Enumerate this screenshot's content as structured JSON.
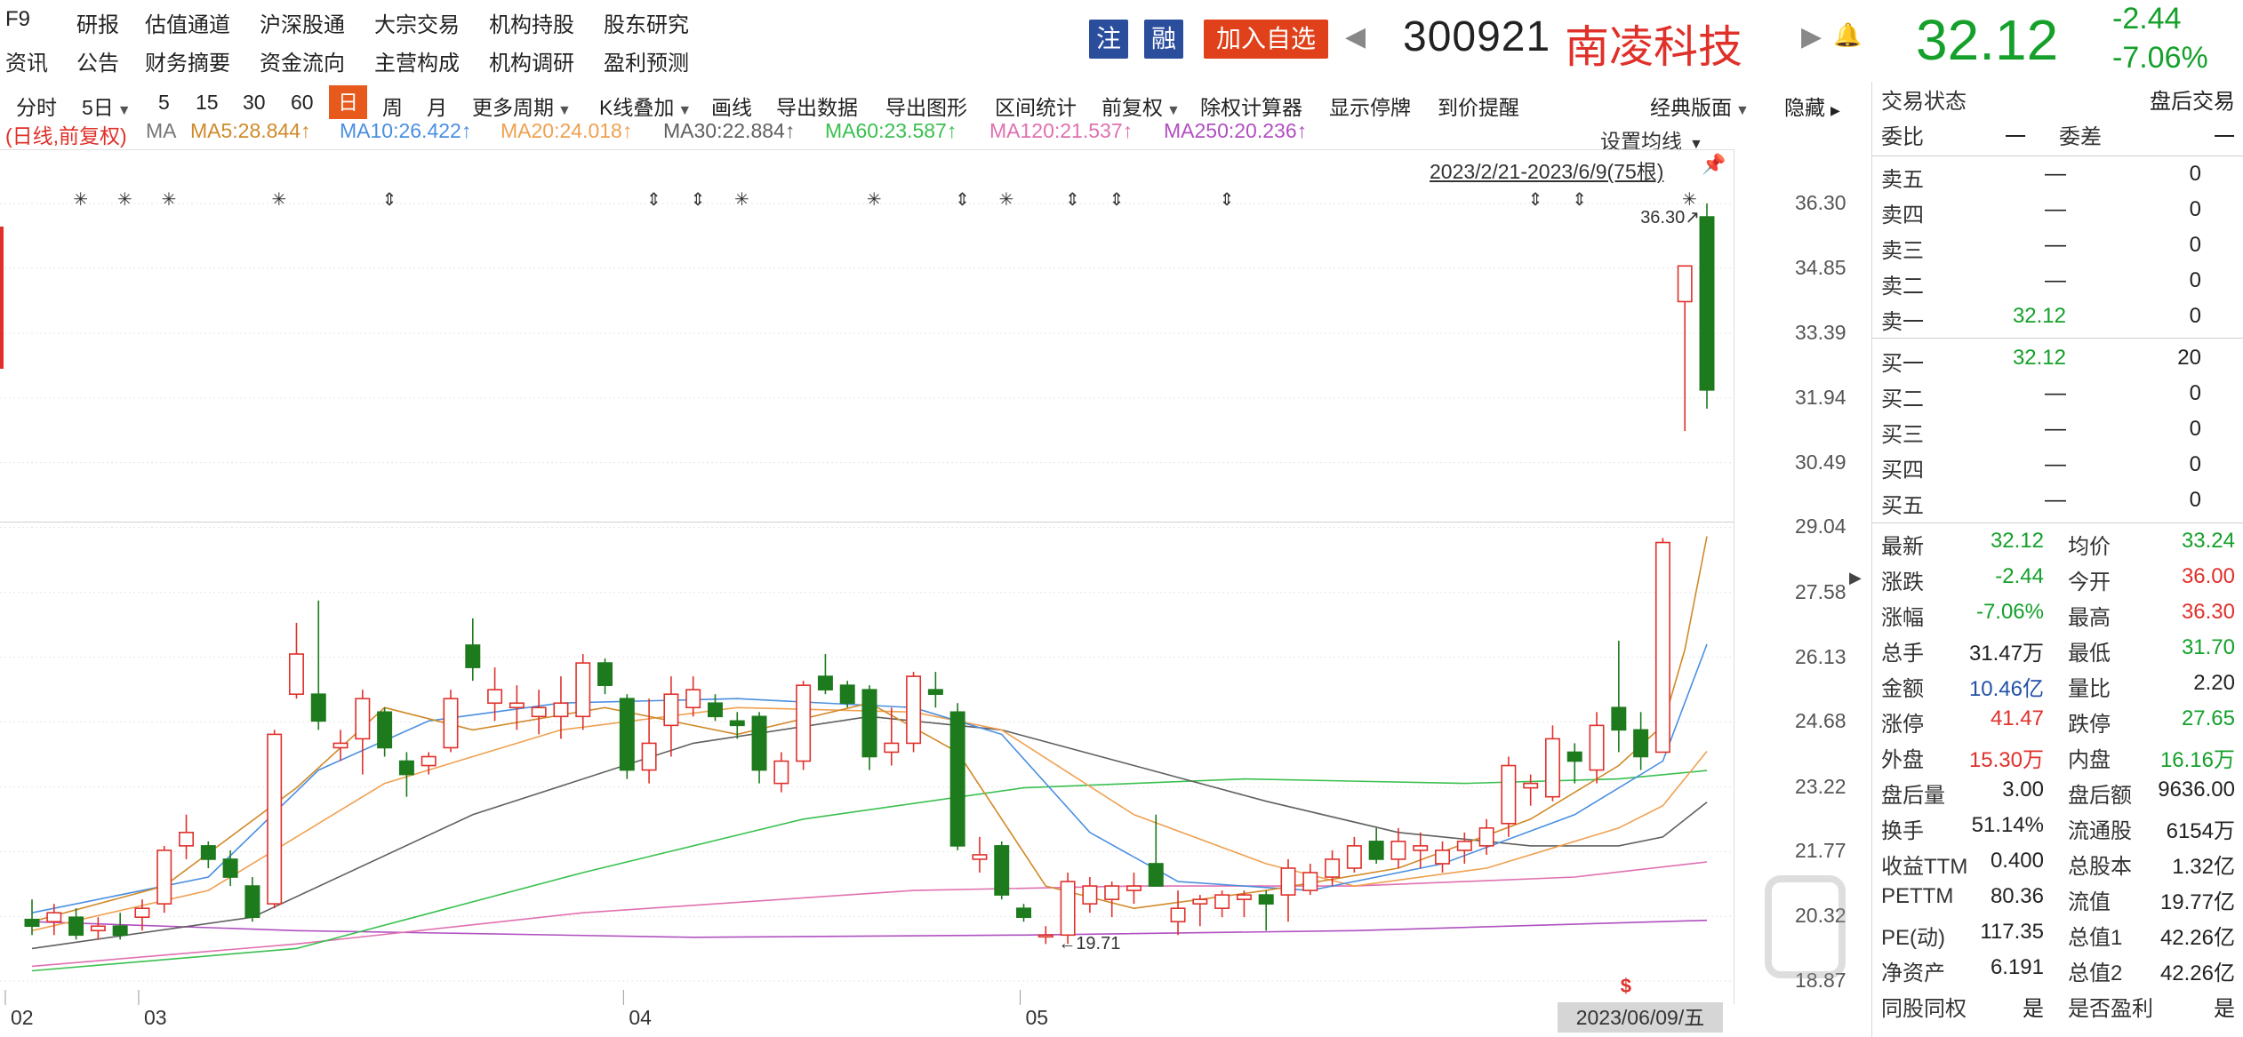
{
  "nav": {
    "row1": [
      "F9",
      "研报",
      "估值通道",
      "沪深股通",
      "大宗交易",
      "机构持股",
      "股东研究"
    ],
    "row2": [
      "资讯",
      "公告",
      "财务摘要",
      "资金流向",
      "主营构成",
      "机构调研",
      "盈利预测"
    ]
  },
  "header": {
    "tag_zhu": "注",
    "tag_rong": "融",
    "add_watch": "加入自选",
    "code": "300921",
    "name": "南凌科技",
    "price": "32.12",
    "change": "-2.44",
    "change_pct": "-7.06%"
  },
  "toolbar": {
    "items": [
      "分时",
      "5日",
      "5",
      "15",
      "30",
      "60",
      "日",
      "周",
      "月",
      "更多周期",
      "K线叠加",
      "画线",
      "导出数据",
      "导出图形",
      "区间统计",
      "前复权",
      "除权计算器",
      "显示停牌",
      "到价提醒",
      "经典版面",
      "隐藏"
    ],
    "active": "日"
  },
  "ma_legend": {
    "mode": "(日线,前复权)",
    "ma": "MA",
    "ma5": "MA5:28.844↑",
    "ma10": "MA10:26.422↑",
    "ma20": "MA20:24.018↑",
    "ma30": "MA30:22.884↑",
    "ma60": "MA60:23.587↑",
    "ma120": "MA120:21.537↑",
    "ma250": "MA250:20.236↑",
    "colors": {
      "ma5": "#d08a2a",
      "ma10": "#4a8fe0",
      "ma20": "#f0a050",
      "ma30": "#606060",
      "ma60": "#3ac050",
      "ma120": "#e070b0",
      "ma250": "#b050c0"
    }
  },
  "chart_controls": {
    "set_ma": "设置均线",
    "range": "2023/2/21-2023/6/9(75根)"
  },
  "chart_data": {
    "type": "candlestick",
    "ylim": [
      18.87,
      36.3
    ],
    "y_ticks": [
      "36.30",
      "34.85",
      "33.39",
      "31.94",
      "30.49",
      "29.04",
      "27.58",
      "26.13",
      "24.68",
      "23.22",
      "21.77",
      "20.32",
      "18.87"
    ],
    "x_ticks": [
      "02",
      "03",
      "04",
      "05"
    ],
    "annotations": {
      "high_label": "36.30",
      "low_label": "19.71"
    },
    "current_date": "2023/06/09/五",
    "up_color": "#e0302a",
    "down_color": "#1d7a1d",
    "candles": [
      {
        "o": 20.25,
        "h": 20.7,
        "l": 19.9,
        "c": 20.1
      },
      {
        "o": 20.2,
        "h": 20.6,
        "l": 19.9,
        "c": 20.4
      },
      {
        "o": 20.3,
        "h": 20.5,
        "l": 19.8,
        "c": 19.9
      },
      {
        "o": 20.0,
        "h": 20.3,
        "l": 19.8,
        "c": 20.1
      },
      {
        "o": 20.1,
        "h": 20.4,
        "l": 19.8,
        "c": 19.9
      },
      {
        "o": 20.3,
        "h": 20.7,
        "l": 20.0,
        "c": 20.5
      },
      {
        "o": 20.6,
        "h": 21.9,
        "l": 20.4,
        "c": 21.8
      },
      {
        "o": 21.9,
        "h": 22.6,
        "l": 21.6,
        "c": 22.2
      },
      {
        "o": 21.9,
        "h": 22.0,
        "l": 21.4,
        "c": 21.6
      },
      {
        "o": 21.6,
        "h": 21.8,
        "l": 21.0,
        "c": 21.2
      },
      {
        "o": 21.0,
        "h": 21.2,
        "l": 20.2,
        "c": 20.3
      },
      {
        "o": 20.6,
        "h": 24.5,
        "l": 20.5,
        "c": 24.4
      },
      {
        "o": 25.3,
        "h": 26.9,
        "l": 25.2,
        "c": 26.2
      },
      {
        "o": 25.3,
        "h": 27.4,
        "l": 24.5,
        "c": 24.7
      },
      {
        "o": 24.1,
        "h": 24.5,
        "l": 23.8,
        "c": 24.2
      },
      {
        "o": 24.3,
        "h": 25.4,
        "l": 23.5,
        "c": 25.2
      },
      {
        "o": 24.9,
        "h": 25.0,
        "l": 23.9,
        "c": 24.1
      },
      {
        "o": 23.8,
        "h": 24.0,
        "l": 23.0,
        "c": 23.5
      },
      {
        "o": 23.7,
        "h": 24.0,
        "l": 23.5,
        "c": 23.9
      },
      {
        "o": 24.1,
        "h": 25.4,
        "l": 24.0,
        "c": 25.2
      },
      {
        "o": 26.4,
        "h": 27.0,
        "l": 25.6,
        "c": 25.9
      },
      {
        "o": 25.1,
        "h": 25.9,
        "l": 24.7,
        "c": 25.4
      },
      {
        "o": 25.0,
        "h": 25.5,
        "l": 24.5,
        "c": 25.1
      },
      {
        "o": 24.8,
        "h": 25.4,
        "l": 24.4,
        "c": 25.0
      },
      {
        "o": 24.8,
        "h": 25.7,
        "l": 24.3,
        "c": 25.1
      },
      {
        "o": 24.8,
        "h": 26.2,
        "l": 24.5,
        "c": 26.0
      },
      {
        "o": 26.0,
        "h": 26.1,
        "l": 25.3,
        "c": 25.5
      },
      {
        "o": 25.2,
        "h": 25.3,
        "l": 23.4,
        "c": 23.6
      },
      {
        "o": 23.6,
        "h": 25.2,
        "l": 23.3,
        "c": 24.2
      },
      {
        "o": 24.6,
        "h": 25.7,
        "l": 23.9,
        "c": 25.3
      },
      {
        "o": 25.0,
        "h": 25.7,
        "l": 24.8,
        "c": 25.4
      },
      {
        "o": 25.1,
        "h": 25.3,
        "l": 24.7,
        "c": 24.8
      },
      {
        "o": 24.7,
        "h": 24.9,
        "l": 24.3,
        "c": 24.6
      },
      {
        "o": 24.8,
        "h": 24.9,
        "l": 23.3,
        "c": 23.6
      },
      {
        "o": 23.3,
        "h": 24.0,
        "l": 23.1,
        "c": 23.8
      },
      {
        "o": 23.8,
        "h": 25.6,
        "l": 23.6,
        "c": 25.5
      },
      {
        "o": 25.7,
        "h": 26.2,
        "l": 25.3,
        "c": 25.4
      },
      {
        "o": 25.5,
        "h": 25.6,
        "l": 25.0,
        "c": 25.1
      },
      {
        "o": 25.4,
        "h": 25.5,
        "l": 23.6,
        "c": 23.9
      },
      {
        "o": 24.0,
        "h": 25.0,
        "l": 23.7,
        "c": 24.2
      },
      {
        "o": 24.2,
        "h": 25.8,
        "l": 24.0,
        "c": 25.7
      },
      {
        "o": 25.4,
        "h": 25.8,
        "l": 25.0,
        "c": 25.3
      },
      {
        "o": 24.9,
        "h": 25.1,
        "l": 21.8,
        "c": 21.9
      },
      {
        "o": 21.6,
        "h": 22.1,
        "l": 21.3,
        "c": 21.7
      },
      {
        "o": 21.9,
        "h": 22.0,
        "l": 20.7,
        "c": 20.8
      },
      {
        "o": 20.5,
        "h": 20.6,
        "l": 20.2,
        "c": 20.3
      },
      {
        "o": 19.9,
        "h": 20.1,
        "l": 19.7,
        "c": 19.9
      },
      {
        "o": 19.9,
        "h": 21.3,
        "l": 19.7,
        "c": 21.1
      },
      {
        "o": 20.6,
        "h": 21.2,
        "l": 20.4,
        "c": 21.0
      },
      {
        "o": 20.7,
        "h": 21.1,
        "l": 20.3,
        "c": 21.0
      },
      {
        "o": 20.9,
        "h": 21.3,
        "l": 20.6,
        "c": 21.0
      },
      {
        "o": 21.5,
        "h": 22.6,
        "l": 21.1,
        "c": 21.0
      },
      {
        "o": 20.2,
        "h": 20.9,
        "l": 19.9,
        "c": 20.5
      },
      {
        "o": 20.6,
        "h": 20.8,
        "l": 20.1,
        "c": 20.7
      },
      {
        "o": 20.5,
        "h": 20.9,
        "l": 20.3,
        "c": 20.8
      },
      {
        "o": 20.7,
        "h": 20.9,
        "l": 20.3,
        "c": 20.8
      },
      {
        "o": 20.8,
        "h": 20.9,
        "l": 20.0,
        "c": 20.6
      },
      {
        "o": 20.8,
        "h": 21.6,
        "l": 20.2,
        "c": 21.4
      },
      {
        "o": 20.9,
        "h": 21.5,
        "l": 20.8,
        "c": 21.3
      },
      {
        "o": 21.2,
        "h": 21.8,
        "l": 21.0,
        "c": 21.6
      },
      {
        "o": 21.4,
        "h": 22.1,
        "l": 21.3,
        "c": 21.9
      },
      {
        "o": 22.0,
        "h": 22.3,
        "l": 21.5,
        "c": 21.6
      },
      {
        "o": 21.6,
        "h": 22.3,
        "l": 21.4,
        "c": 22.0
      },
      {
        "o": 21.8,
        "h": 22.2,
        "l": 21.4,
        "c": 21.9
      },
      {
        "o": 21.5,
        "h": 22.0,
        "l": 21.3,
        "c": 21.8
      },
      {
        "o": 21.8,
        "h": 22.2,
        "l": 21.5,
        "c": 22.0
      },
      {
        "o": 21.9,
        "h": 22.5,
        "l": 21.7,
        "c": 22.3
      },
      {
        "o": 22.4,
        "h": 23.9,
        "l": 22.1,
        "c": 23.7
      },
      {
        "o": 23.2,
        "h": 23.5,
        "l": 22.8,
        "c": 23.3
      },
      {
        "o": 23.0,
        "h": 24.6,
        "l": 22.9,
        "c": 24.3
      },
      {
        "o": 24.0,
        "h": 24.2,
        "l": 23.3,
        "c": 23.8
      },
      {
        "o": 23.6,
        "h": 24.9,
        "l": 23.3,
        "c": 24.6
      },
      {
        "o": 25.0,
        "h": 26.5,
        "l": 24.0,
        "c": 24.5
      },
      {
        "o": 24.5,
        "h": 24.9,
        "l": 23.6,
        "c": 23.9
      },
      {
        "o": 24.0,
        "h": 28.8,
        "l": 24.0,
        "c": 28.7
      },
      {
        "o": 34.1,
        "h": 34.9,
        "l": 31.2,
        "c": 34.9
      },
      {
        "o": 36.0,
        "h": 36.3,
        "l": 31.7,
        "c": 32.12
      }
    ],
    "ma_lines": {
      "ma250": [
        [
          0,
          20.2
        ],
        [
          12,
          20.0
        ],
        [
          30,
          19.85
        ],
        [
          45,
          19.9
        ],
        [
          60,
          20.0
        ],
        [
          76,
          20.23
        ]
      ],
      "ma120": [
        [
          0,
          19.2
        ],
        [
          12,
          19.7
        ],
        [
          25,
          20.4
        ],
        [
          40,
          20.9
        ],
        [
          50,
          21.0
        ],
        [
          60,
          21.0
        ],
        [
          70,
          21.2
        ],
        [
          76,
          21.54
        ]
      ],
      "ma60": [
        [
          0,
          19.1
        ],
        [
          12,
          19.6
        ],
        [
          25,
          21.3
        ],
        [
          35,
          22.5
        ],
        [
          45,
          23.2
        ],
        [
          55,
          23.4
        ],
        [
          65,
          23.3
        ],
        [
          72,
          23.4
        ],
        [
          76,
          23.59
        ]
      ],
      "ma30": [
        [
          0,
          19.6
        ],
        [
          10,
          20.3
        ],
        [
          20,
          22.6
        ],
        [
          30,
          24.2
        ],
        [
          38,
          24.8
        ],
        [
          44,
          24.5
        ],
        [
          50,
          23.7
        ],
        [
          56,
          22.9
        ],
        [
          62,
          22.2
        ],
        [
          68,
          21.9
        ],
        [
          72,
          21.9
        ],
        [
          74,
          22.1
        ],
        [
          76,
          22.88
        ]
      ],
      "ma20": [
        [
          0,
          20.0
        ],
        [
          8,
          20.9
        ],
        [
          16,
          23.3
        ],
        [
          24,
          24.5
        ],
        [
          32,
          25.0
        ],
        [
          40,
          24.9
        ],
        [
          44,
          24.5
        ],
        [
          50,
          22.6
        ],
        [
          56,
          21.5
        ],
        [
          60,
          21.0
        ],
        [
          66,
          21.4
        ],
        [
          72,
          22.3
        ],
        [
          74,
          22.8
        ],
        [
          76,
          24.02
        ]
      ],
      "ma10": [
        [
          0,
          20.4
        ],
        [
          8,
          21.2
        ],
        [
          13,
          23.6
        ],
        [
          18,
          24.7
        ],
        [
          24,
          25.1
        ],
        [
          32,
          25.2
        ],
        [
          40,
          25.0
        ],
        [
          44,
          24.4
        ],
        [
          48,
          22.2
        ],
        [
          52,
          21.1
        ],
        [
          58,
          20.9
        ],
        [
          64,
          21.5
        ],
        [
          70,
          22.6
        ],
        [
          74,
          23.8
        ],
        [
          76,
          26.42
        ]
      ],
      "ma5": [
        [
          0,
          20.2
        ],
        [
          6,
          21.0
        ],
        [
          12,
          23.2
        ],
        [
          16,
          25.0
        ],
        [
          20,
          24.5
        ],
        [
          26,
          25.0
        ],
        [
          32,
          24.4
        ],
        [
          38,
          25.1
        ],
        [
          42,
          24.0
        ],
        [
          46,
          21.0
        ],
        [
          50,
          20.5
        ],
        [
          56,
          20.9
        ],
        [
          62,
          21.4
        ],
        [
          68,
          22.5
        ],
        [
          72,
          23.7
        ],
        [
          74,
          24.6
        ],
        [
          75,
          26.3
        ],
        [
          76,
          28.84
        ]
      ]
    }
  },
  "quote": {
    "trade_status_label": "交易状态",
    "trade_status_value": "盘后交易",
    "weibi_label": "委比",
    "weibi_value": "一",
    "weicha_label": "委差",
    "weicha_value": "一",
    "asks": [
      {
        "label": "卖五",
        "price": "—",
        "vol": "0"
      },
      {
        "label": "卖四",
        "price": "—",
        "vol": "0"
      },
      {
        "label": "卖三",
        "price": "—",
        "vol": "0"
      },
      {
        "label": "卖二",
        "price": "—",
        "vol": "0"
      },
      {
        "label": "卖一",
        "price": "32.12",
        "vol": "0"
      }
    ],
    "bids": [
      {
        "label": "买一",
        "price": "32.12",
        "vol": "20"
      },
      {
        "label": "买二",
        "price": "—",
        "vol": "0"
      },
      {
        "label": "买三",
        "price": "—",
        "vol": "0"
      },
      {
        "label": "买四",
        "price": "—",
        "vol": "0"
      },
      {
        "label": "买五",
        "price": "—",
        "vol": "0"
      }
    ],
    "stats": [
      [
        "最新",
        "32.12",
        "green",
        "均价",
        "33.24",
        "green"
      ],
      [
        "涨跌",
        "-2.44",
        "green",
        "今开",
        "36.00",
        "red"
      ],
      [
        "涨幅",
        "-7.06%",
        "green",
        "最高",
        "36.30",
        "red"
      ],
      [
        "总手",
        "31.47万",
        "dark",
        "最低",
        "31.70",
        "green"
      ],
      [
        "金额",
        "10.46亿",
        "blue",
        "量比",
        "2.20",
        "dark"
      ],
      [
        "涨停",
        "41.47",
        "red",
        "跌停",
        "27.65",
        "green"
      ],
      [
        "外盘",
        "15.30万",
        "red",
        "内盘",
        "16.16万",
        "green"
      ],
      [
        "盘后量",
        "3.00",
        "dark",
        "盘后额",
        "9636.00",
        "dark"
      ],
      [
        "换手",
        "51.14%",
        "dark",
        "流通股",
        "6154万",
        "dark"
      ],
      [
        "收益TTM",
        "0.400",
        "dark",
        "总股本",
        "1.32亿",
        "dark"
      ],
      [
        "PETTM",
        "80.36",
        "dark",
        "流值",
        "19.77亿",
        "dark"
      ],
      [
        "PE(动)",
        "117.35",
        "dark",
        "总值1",
        "42.26亿",
        "dark"
      ],
      [
        "净资产",
        "6.191",
        "dark",
        "总值2",
        "42.26亿",
        "dark"
      ],
      [
        "同股同权",
        "是",
        "dark",
        "是否盈利",
        "是",
        "dark"
      ]
    ]
  }
}
